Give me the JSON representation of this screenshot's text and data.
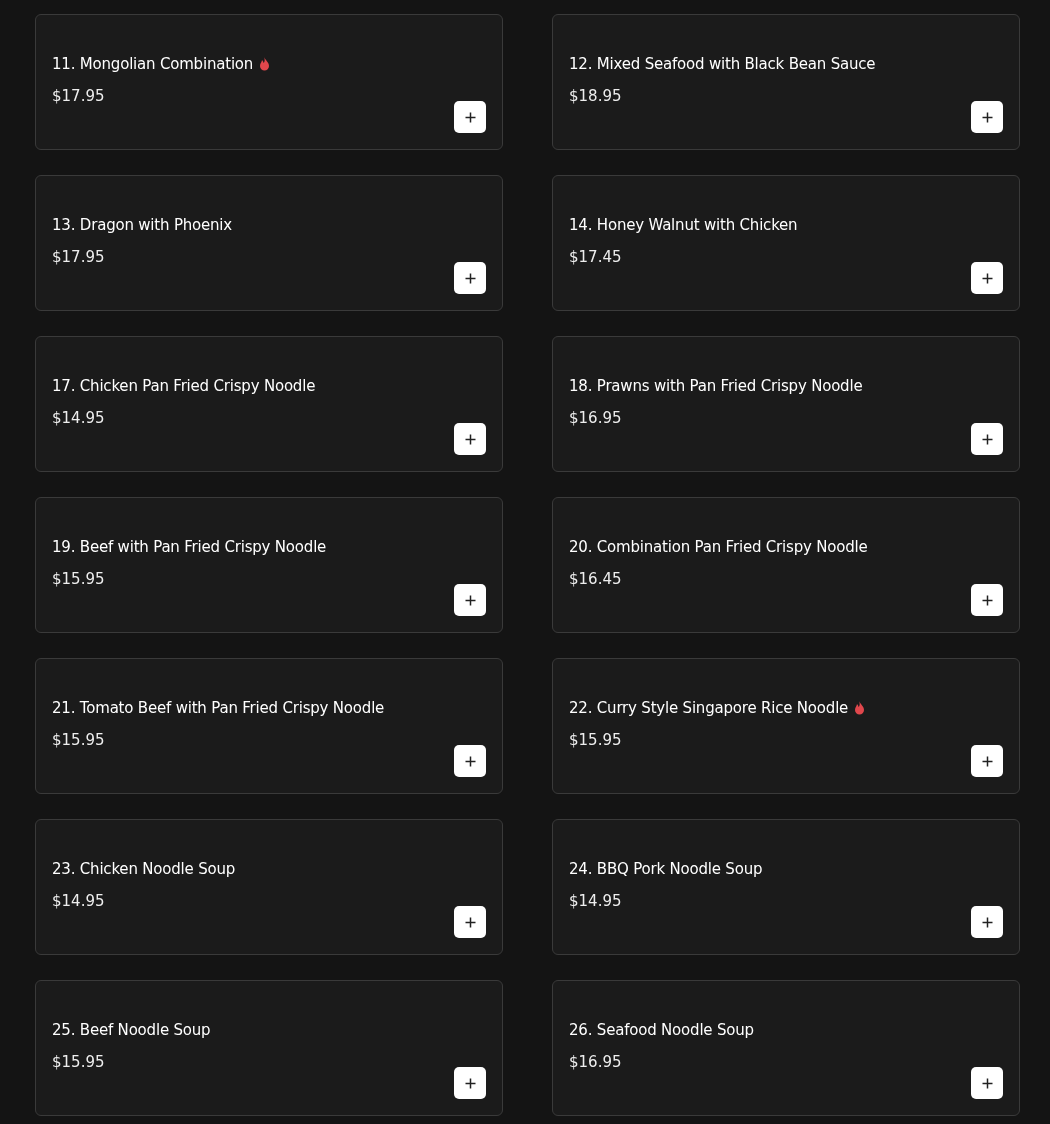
{
  "items": [
    {
      "name": "11. Mongolian Combination",
      "price": "$17.95",
      "spicy": true
    },
    {
      "name": "12. Mixed Seafood with Black Bean Sauce",
      "price": "$18.95",
      "spicy": false
    },
    {
      "name": "13. Dragon with Phoenix",
      "price": "$17.95",
      "spicy": false
    },
    {
      "name": "14. Honey Walnut with Chicken",
      "price": "$17.45",
      "spicy": false
    },
    {
      "name": "17. Chicken Pan Fried Crispy Noodle",
      "price": "$14.95",
      "spicy": false
    },
    {
      "name": "18. Prawns with Pan Fried Crispy Noodle",
      "price": "$16.95",
      "spicy": false
    },
    {
      "name": "19. Beef with Pan Fried Crispy Noodle",
      "price": "$15.95",
      "spicy": false
    },
    {
      "name": "20. Combination Pan Fried Crispy Noodle",
      "price": "$16.45",
      "spicy": false
    },
    {
      "name": "21. Tomato Beef with Pan Fried Crispy Noodle",
      "price": "$15.95",
      "spicy": false
    },
    {
      "name": "22. Curry Style Singapore Rice Noodle",
      "price": "$15.95",
      "spicy": true
    },
    {
      "name": "23. Chicken Noodle Soup",
      "price": "$14.95",
      "spicy": false
    },
    {
      "name": "24. BBQ Pork Noodle Soup",
      "price": "$14.95",
      "spicy": false
    },
    {
      "name": "25. Beef Noodle Soup",
      "price": "$15.95",
      "spicy": false
    },
    {
      "name": "26. Seafood Noodle Soup",
      "price": "$16.95",
      "spicy": false
    }
  ]
}
